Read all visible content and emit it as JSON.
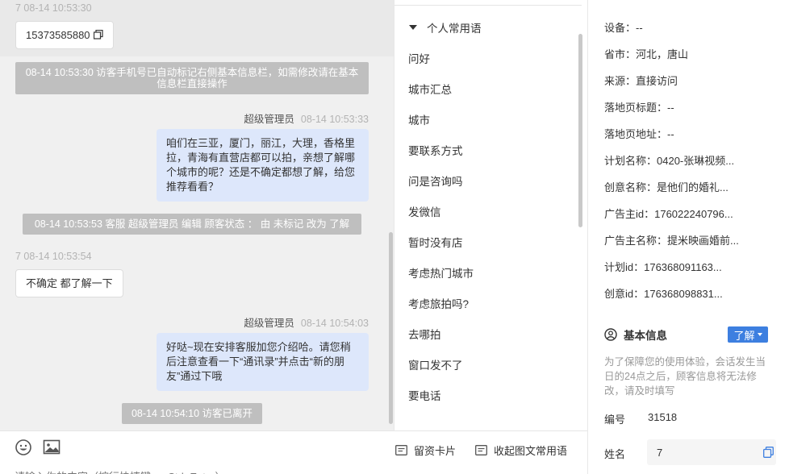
{
  "chat": {
    "messages": [
      {
        "meta_time": "7 08-14 10:53:30",
        "text": "15373585880"
      },
      {
        "system": "08-14 10:53:30 访客手机号已自动标记右侧基本信息栏，如需修改请在基本信息栏直接操作"
      },
      {
        "sender": "超级管理员",
        "time": "08-14 10:53:33",
        "text": "咱们在三亚，厦门，丽江，大理，香格里拉，青海有直营店都可以拍，亲想了解哪个城市的呢？还是不确定都想了解，给您推荐看看？"
      },
      {
        "system": "08-14 10:53:53 客服 超级管理员 编辑 顾客状态 ： 由 未标记 改为 了解"
      },
      {
        "meta_time": "7 08-14 10:53:54",
        "text": "不确定 都了解一下"
      },
      {
        "sender": "超级管理员",
        "time": "08-14 10:54:03",
        "text": "好哒~现在安排客服加您介绍哈。请您稍后注意查看一下“通讯录”并点击“新的朋友”通过下哦"
      },
      {
        "system": "08-14 10:54:10 访客已离开"
      }
    ]
  },
  "composer": {
    "card_label": "留资卡片",
    "collapse_label": "收起图文常用语",
    "input_placeholder": "请输入你的内容（按行快捷键，+Ctrl+Enter）"
  },
  "phrases": {
    "group_title": "个人常用语",
    "items": [
      "问好",
      "城市汇总",
      "城市",
      "要联系方式",
      "问是咨询吗",
      "发微信",
      "暂时没有店",
      "考虑热门城市",
      "考虑旅拍吗?",
      "去哪拍",
      "窗口发不了",
      "要电话"
    ]
  },
  "info": {
    "rows": [
      "设备：--",
      "省市：河北，唐山",
      "来源：直接访问",
      "落地页标题：--",
      "落地页地址：--",
      "计划名称：0420-张琳视频...",
      "创意名称：是他们的婚礼...",
      "广告主id：176022240796...",
      "广告主名称：提米映画婚前...",
      "计划id：176368091163...",
      "创意id：176368098831..."
    ],
    "basic_title": "基本信息",
    "know_label": "了解",
    "notice": "为了保障您的使用体验，会话发生当日的24点之后，顾客信息将无法修改，请及时填写",
    "id_label": "编号",
    "id_value": "31518",
    "name_label": "姓名",
    "name_value": "7"
  }
}
